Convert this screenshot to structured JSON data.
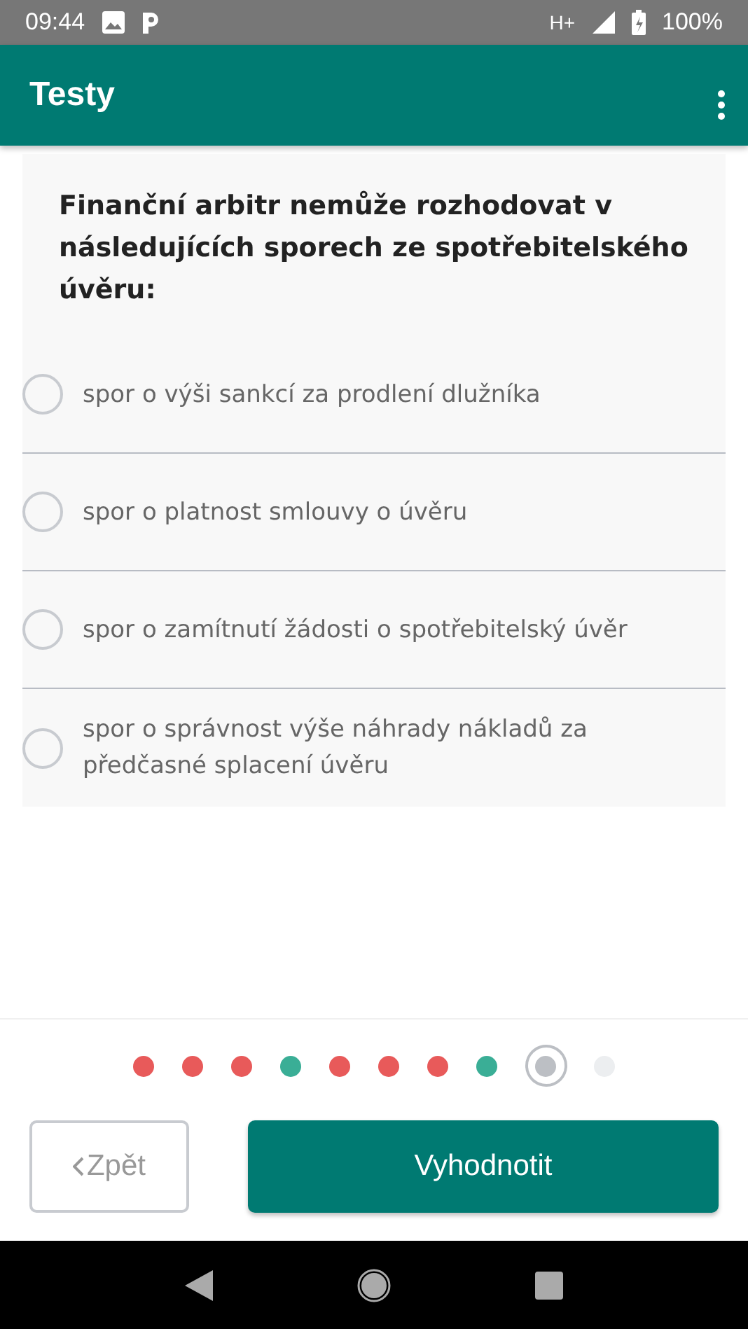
{
  "status_bar": {
    "time": "09:44",
    "network": "H+",
    "battery": "100%"
  },
  "app_bar": {
    "title": "Testy"
  },
  "question": "Finanční arbitr nemůže rozhodovat v následujících sporech ze spotřebitelského úvěru:",
  "options": [
    {
      "label": "spor o výši sankcí za prodlení dlužníka",
      "selected": false
    },
    {
      "label": "spor o platnost smlouvy o úvěru",
      "selected": false
    },
    {
      "label": "spor o zamítnutí žádosti o spotřebitelský úvěr",
      "selected": false
    },
    {
      "label": "spor o správnost výše náhrady nákladů za předčasné splacení úvěru",
      "selected": false
    }
  ],
  "progress": [
    {
      "color": "#e85a5a",
      "selected": false
    },
    {
      "color": "#e85a5a",
      "selected": false
    },
    {
      "color": "#e85a5a",
      "selected": false
    },
    {
      "color": "#3aae96",
      "selected": false
    },
    {
      "color": "#e85a5a",
      "selected": false
    },
    {
      "color": "#e85a5a",
      "selected": false
    },
    {
      "color": "#e85a5a",
      "selected": false
    },
    {
      "color": "#3aae96",
      "selected": false
    },
    {
      "color": "#bcbfc4",
      "selected": true
    },
    {
      "color": "#eceef0",
      "selected": false
    }
  ],
  "buttons": {
    "back": "Zpět",
    "submit": "Vyhodnotit"
  }
}
